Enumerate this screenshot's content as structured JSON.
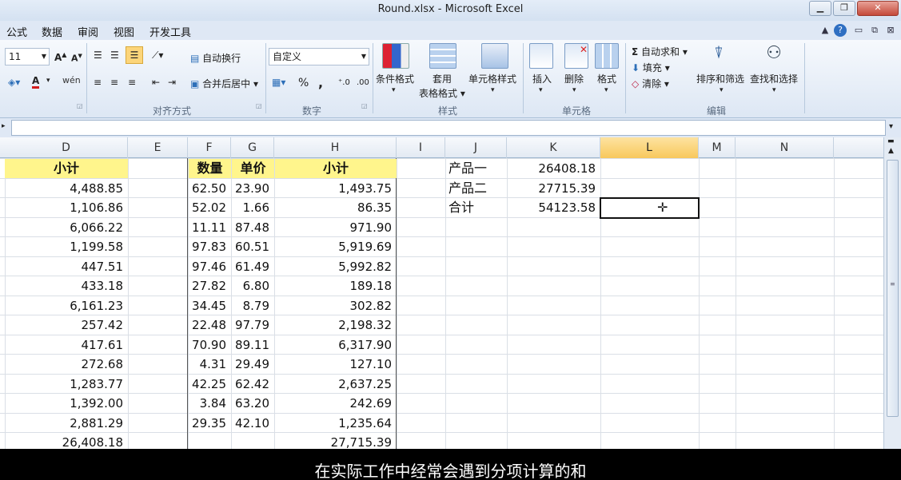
{
  "window": {
    "title": "Round.xlsx - Microsoft Excel"
  },
  "menu": {
    "tabs": [
      "公式",
      "数据",
      "审阅",
      "视图",
      "开发工具"
    ]
  },
  "ribbon": {
    "font_size": "11",
    "wrap_text": "自动换行",
    "merge_center": "合并后居中",
    "align_group": "对齐方式",
    "number_format": "自定义",
    "percent": "%",
    "comma": ",",
    "number_group": "数字",
    "conditional": "条件格式",
    "table_format_1": "套用",
    "table_format_2": "表格格式",
    "cell_style": "单元格样式",
    "styles_group": "样式",
    "insert": "插入",
    "delete": "删除",
    "format": "格式",
    "cells_group": "单元格",
    "autosum": "自动求和",
    "fill": "填充",
    "clear": "清除",
    "sort_filter": "排序和筛选",
    "find_select": "查找和选择",
    "edit_group": "编辑"
  },
  "columns": [
    "D",
    "E",
    "F",
    "G",
    "H",
    "I",
    "J",
    "K",
    "L",
    "M",
    "N"
  ],
  "selected_column": "L",
  "headers": {
    "d": "小计",
    "f": "数量",
    "g": "单价",
    "h": "小计"
  },
  "col_d": [
    "4,488.85",
    "1,106.86",
    "6,066.22",
    "1,199.58",
    "447.51",
    "433.18",
    "6,161.23",
    "257.42",
    "417.61",
    "272.68",
    "1,283.77",
    "1,392.00",
    "2,881.29",
    "26,408.18"
  ],
  "col_f": [
    "62.50",
    "52.02",
    "11.11",
    "97.83",
    "97.46",
    "27.82",
    "34.45",
    "22.48",
    "70.90",
    "4.31",
    "42.25",
    "3.84",
    "29.35"
  ],
  "col_g": [
    "23.90",
    "1.66",
    "87.48",
    "60.51",
    "61.49",
    "6.80",
    "8.79",
    "97.79",
    "89.11",
    "29.49",
    "62.42",
    "63.20",
    "42.10"
  ],
  "col_h": [
    "1,493.75",
    "86.35",
    "971.90",
    "5,919.69",
    "5,992.82",
    "189.18",
    "302.82",
    "2,198.32",
    "6,317.90",
    "127.10",
    "2,637.25",
    "242.69",
    "1,235.64",
    "27,715.39"
  ],
  "summary": [
    {
      "label": "产品一",
      "value": "26408.18"
    },
    {
      "label": "产品二",
      "value": "27715.39"
    },
    {
      "label": "合计",
      "value": "54123.58"
    }
  ],
  "subtitle": "在实际工作中经常会遇到分项计算的和"
}
